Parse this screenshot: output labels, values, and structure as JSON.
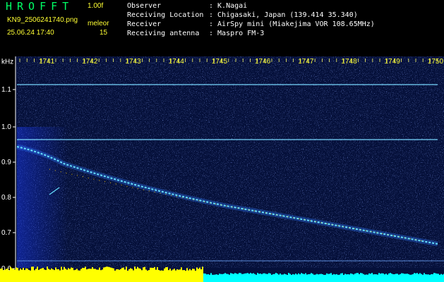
{
  "header": {
    "app_title": "HROFFT",
    "version": "1.00f",
    "filename": "KN9_2506241740.png",
    "datetime": "25.06.24 17:40",
    "mode_label": "meleor",
    "mode_value": "15"
  },
  "info": [
    {
      "label": "Observer",
      "value": ": K.Nagai"
    },
    {
      "label": "Receiving Location",
      "value": ": Chigasaki, Japan (139.414 35.340)"
    },
    {
      "label": "Receiver",
      "value": ": AirSpy mini (Miakejima VOR 108.65MHz)"
    },
    {
      "label": "Receiving antenna",
      "value": ": Maspro FM-3"
    }
  ],
  "spectrogram": {
    "y_unit": "kHz",
    "y_ticks": [
      "1.1",
      "1.0",
      "0.9",
      "0.8",
      "0.7",
      "0.6"
    ],
    "time_ticks": [
      "1741",
      "1742",
      "1743",
      "1744",
      "1745",
      "1746",
      "1747",
      "1748",
      "1749",
      "1750"
    ],
    "colors": {
      "background": "#05103a",
      "noise": "#3a5cff",
      "trace": "#66e0ff",
      "trace_hot": "#ffcc00",
      "level_left": "#ffff00",
      "level_right": "#00ffff"
    }
  }
}
